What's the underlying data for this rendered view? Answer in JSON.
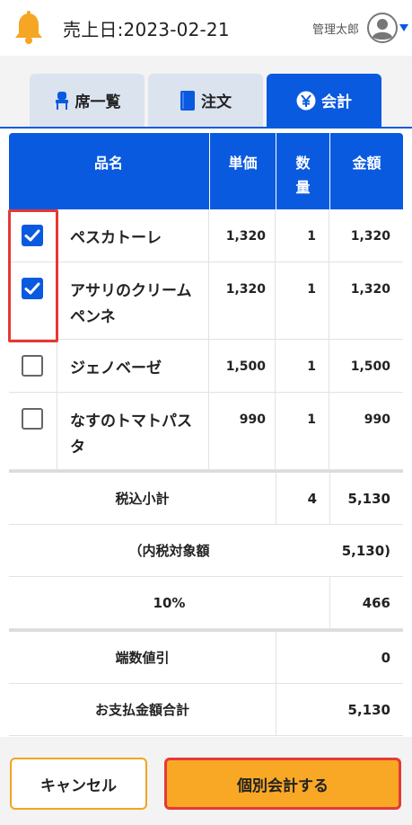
{
  "header": {
    "sales_date_label": "売上日:2023-02-21",
    "user_name": "管理太郎"
  },
  "tabs": [
    {
      "label": "席一覧",
      "icon": "chair-icon",
      "active": false
    },
    {
      "label": "注文",
      "icon": "book-icon",
      "active": false
    },
    {
      "label": "会計",
      "icon": "yen-icon",
      "active": true
    }
  ],
  "table": {
    "headers": {
      "name": "品名",
      "price": "単価",
      "qty_line1": "数",
      "qty_line2": "量",
      "amount": "金額"
    },
    "rows": [
      {
        "name": "ペスカトーレ",
        "price": "1,320",
        "qty": "1",
        "amount": "1,320",
        "checked": true
      },
      {
        "name": "アサリのクリームペンネ",
        "price": "1,320",
        "qty": "1",
        "amount": "1,320",
        "checked": true
      },
      {
        "name": "ジェノベーゼ",
        "price": "1,500",
        "qty": "1",
        "amount": "1,500",
        "checked": false
      },
      {
        "name": "なすのトマトパスタ",
        "price": "990",
        "qty": "1",
        "amount": "990",
        "checked": false
      }
    ]
  },
  "summary": {
    "subtotal_label": "税込小計",
    "subtotal_qty": "4",
    "subtotal_amount": "5,130",
    "taxable_label": "（内税対象額",
    "taxable_amount": "5,130)",
    "tax_rate_label": "10%",
    "tax_amount": "466",
    "rounding_label": "端数値引",
    "rounding_amount": "0",
    "total_label": "お支払金額合計",
    "total_amount": "5,130"
  },
  "buttons": {
    "cancel": "キャンセル",
    "split_pay": "個別会計する"
  },
  "colors": {
    "primary": "#0a5ae0",
    "accent": "#f9a825",
    "highlight": "#e53935"
  }
}
